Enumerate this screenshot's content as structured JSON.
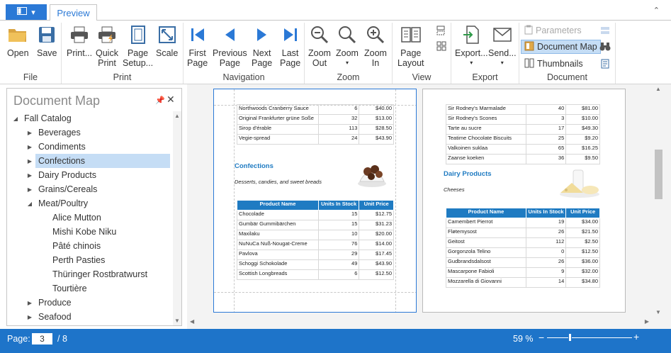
{
  "tabs": {
    "preview": "Preview"
  },
  "ribbon": {
    "groups": {
      "file": "File",
      "print": "Print",
      "navigation": "Navigation",
      "zoom": "Zoom",
      "view": "View",
      "export": "Export",
      "document": "Document"
    },
    "buttons": {
      "open": "Open",
      "save": "Save",
      "print": "Print...",
      "quick_print": "Quick\nPrint",
      "page_setup": "Page\nSetup...",
      "scale": "Scale",
      "first_page": "First\nPage",
      "previous_page": "Previous\nPage",
      "next_page": "Next\nPage",
      "last_page": "Last\nPage",
      "zoom_out": "Zoom\nOut",
      "zoom": "Zoom",
      "zoom_in": "Zoom\nIn",
      "page_layout": "Page\nLayout",
      "export": "Export...",
      "send": "Send...",
      "parameters": "Parameters",
      "document_map": "Document Map",
      "thumbnails": "Thumbnails"
    }
  },
  "document_map": {
    "title": "Document Map",
    "tree": [
      {
        "label": "Fall Catalog",
        "level": 0,
        "expander": "expanded"
      },
      {
        "label": "Beverages",
        "level": 1,
        "expander": "collapsed"
      },
      {
        "label": "Condiments",
        "level": 1,
        "expander": "collapsed"
      },
      {
        "label": "Confections",
        "level": 1,
        "expander": "collapsed",
        "selected": true
      },
      {
        "label": "Dairy Products",
        "level": 1,
        "expander": "collapsed"
      },
      {
        "label": "Grains/Cereals",
        "level": 1,
        "expander": "collapsed"
      },
      {
        "label": "Meat/Poultry",
        "level": 1,
        "expander": "expanded"
      },
      {
        "label": "Alice Mutton",
        "level": 2
      },
      {
        "label": "Mishi Kobe Niku",
        "level": 2
      },
      {
        "label": "Pâté chinois",
        "level": 2
      },
      {
        "label": "Perth Pasties",
        "level": 2
      },
      {
        "label": "Thüringer Rostbratwurst",
        "level": 2
      },
      {
        "label": "Tourtière",
        "level": 2
      },
      {
        "label": "Produce",
        "level": 1,
        "expander": "collapsed"
      },
      {
        "label": "Seafood",
        "level": 1,
        "expander": "collapsed"
      }
    ]
  },
  "pages": {
    "left": {
      "top_rows": [
        [
          "Northwoods Cranberry Sauce",
          "6",
          "$40.00"
        ],
        [
          "Original Frankfurter grüne Soße",
          "32",
          "$13.00"
        ],
        [
          "Sirop d'érable",
          "113",
          "$28.50"
        ],
        [
          "Vegie-spread",
          "24",
          "$43.90"
        ]
      ],
      "category": "Confections",
      "description": "Desserts, candies, and sweet breads",
      "headers": [
        "Product Name",
        "Units In Stock",
        "Unit Price"
      ],
      "rows": [
        [
          "Chocolade",
          "15",
          "$12.75"
        ],
        [
          "Gumbär Gummibärchen",
          "15",
          "$31.23"
        ],
        [
          "Maxilaku",
          "10",
          "$20.00"
        ],
        [
          "NuNuCa Nuß-Nougat-Creme",
          "76",
          "$14.00"
        ],
        [
          "Pavlova",
          "29",
          "$17.45"
        ],
        [
          "Schoggi Schokolade",
          "49",
          "$43.90"
        ],
        [
          "Scottish Longbreads",
          "6",
          "$12.50"
        ]
      ]
    },
    "right": {
      "top_rows": [
        [
          "Sir Rodney's Marmalade",
          "40",
          "$81.00"
        ],
        [
          "Sir Rodney's Scones",
          "3",
          "$10.00"
        ],
        [
          "Tarte au sucre",
          "17",
          "$49.30"
        ],
        [
          "Teatime Chocolate Biscuits",
          "25",
          "$9.20"
        ],
        [
          "Valkoinen suklaa",
          "65",
          "$16.25"
        ],
        [
          "Zaanse koeken",
          "36",
          "$9.50"
        ]
      ],
      "category": "Dairy Products",
      "description": "Cheeses",
      "headers": [
        "Product Name",
        "Units In Stock",
        "Unit Price"
      ],
      "rows": [
        [
          "Camembert Pierrot",
          "19",
          "$34.00"
        ],
        [
          "Fløtemysost",
          "26",
          "$21.50"
        ],
        [
          "Geitost",
          "112",
          "$2.50"
        ],
        [
          "Gorgonzola Telino",
          "0",
          "$12.50"
        ],
        [
          "Gudbrandsdalsost",
          "26",
          "$36.00"
        ],
        [
          "Mascarpone Fabioli",
          "9",
          "$32.00"
        ],
        [
          "Mozzarella di Giovanni",
          "14",
          "$34.80"
        ]
      ]
    }
  },
  "status": {
    "page_label": "Page:",
    "current_page": "3",
    "total_pages": "/ 8",
    "zoom": "59 %",
    "zoom_fraction": 0.27
  },
  "colors": {
    "accent": "#2b79d6",
    "statusbar": "#1e74c9",
    "table_header": "#1f7bc2"
  }
}
